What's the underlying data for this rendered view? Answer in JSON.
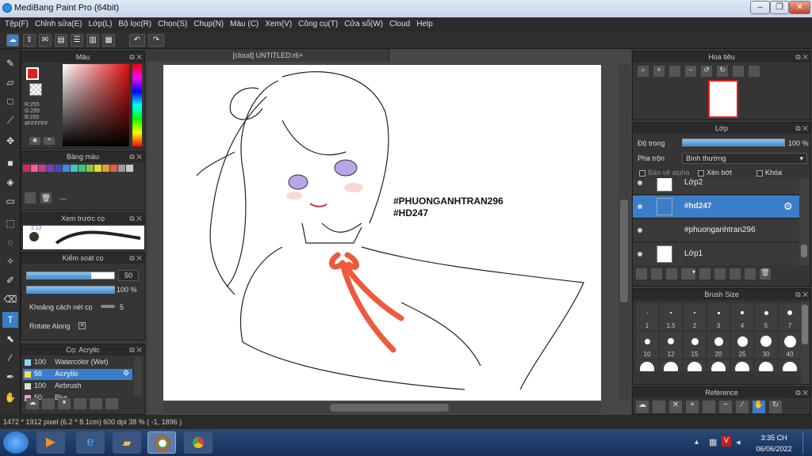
{
  "window": {
    "title": "MediBang Paint Pro (64bit)"
  },
  "menu": [
    "Tệp(F)",
    "Chỉnh sửa(E)",
    "Lớp(L)",
    "Bộ lọc(R)",
    "Chọn(S)",
    "Chụp(N)",
    "Màu (C)",
    "Xem(V)",
    "Công cụ(T)",
    "Cửa sổ(W)",
    "Cloud",
    "Help"
  ],
  "canvas": {
    "tab_title": "[cloud] UNTITLED:r6+",
    "text_line1": "#PHUONGANHTRAN296",
    "text_line2": "#HD247"
  },
  "color_panel": {
    "title": "Màu",
    "r": "R:255",
    "g": "G:255",
    "b": "B:255",
    "hex": "#FFFFFF"
  },
  "palette_panel": {
    "title": "Bảng màu",
    "placeholder": "---",
    "swatches": [
      "#e0245e",
      "#ff5a8a",
      "#c83c96",
      "#7a3cc8",
      "#3c4cc8",
      "#3c8ce0",
      "#3cc8c8",
      "#3cc878",
      "#8cc83c",
      "#e0e03c",
      "#e0a03c",
      "#e0603c",
      "#9a9a9a",
      "#c8c8c8"
    ]
  },
  "brush_preview": {
    "title": "Xem trước cọ",
    "size": "2.12"
  },
  "brush_control": {
    "title": "Kiểm soát cọ",
    "size_value": "50",
    "opacity_value": "100 %",
    "spacing_label": "Khoảng cách nét cọ",
    "spacing_value": "5",
    "rotate_label": "Rotate Along"
  },
  "brush_list": {
    "title": "Cọ: Acrylic",
    "items": [
      {
        "size": "100",
        "name": "Watercolor (Wet)",
        "color": "#8fd3f4"
      },
      {
        "size": "50",
        "name": "Acrylic",
        "color": "#f0e040"
      },
      {
        "size": "100",
        "name": "Airbrush",
        "color": "#dddddd"
      },
      {
        "size": "50",
        "name": "Blur",
        "color": "#e0a0e0"
      }
    ]
  },
  "navigator": {
    "title": "Hoa tiêu"
  },
  "layers": {
    "title": "Lớp",
    "opacity_label": "Độ trong",
    "opacity_value": "100 %",
    "opacity_fraction": 1.0,
    "blend_label": "Pha trộn",
    "blend_value": "Bình thường",
    "protect_alpha": "Bảo vệ alpha",
    "clipping": "Xén bớt",
    "lock": "Khóa",
    "rows": [
      {
        "name": "Lớp2",
        "selected": false
      },
      {
        "name": "#hd247",
        "selected": true
      },
      {
        "name": "#phuonganhtran296",
        "selected": false
      },
      {
        "name": "Lớp1",
        "selected": false
      }
    ]
  },
  "brush_size": {
    "title": "Brush Size",
    "row1": [
      "1",
      "1.5",
      "2",
      "3",
      "4",
      "5",
      "7"
    ],
    "row2": [
      "10",
      "12",
      "15",
      "20",
      "25",
      "30",
      "40"
    ]
  },
  "reference": {
    "title": "Reference"
  },
  "status": {
    "text": "1472 * 1912 pixel   (6.2 * 8.1cm)   600 dpi   38 %   ( -1, 1896 )"
  },
  "taskbar": {
    "time": "3:35 CH",
    "date": "06/06/2022"
  },
  "colors": {
    "accent": "#3a7ec9",
    "panel": "#353535",
    "bg": "#474747",
    "ribbon": "#f05a3c"
  }
}
